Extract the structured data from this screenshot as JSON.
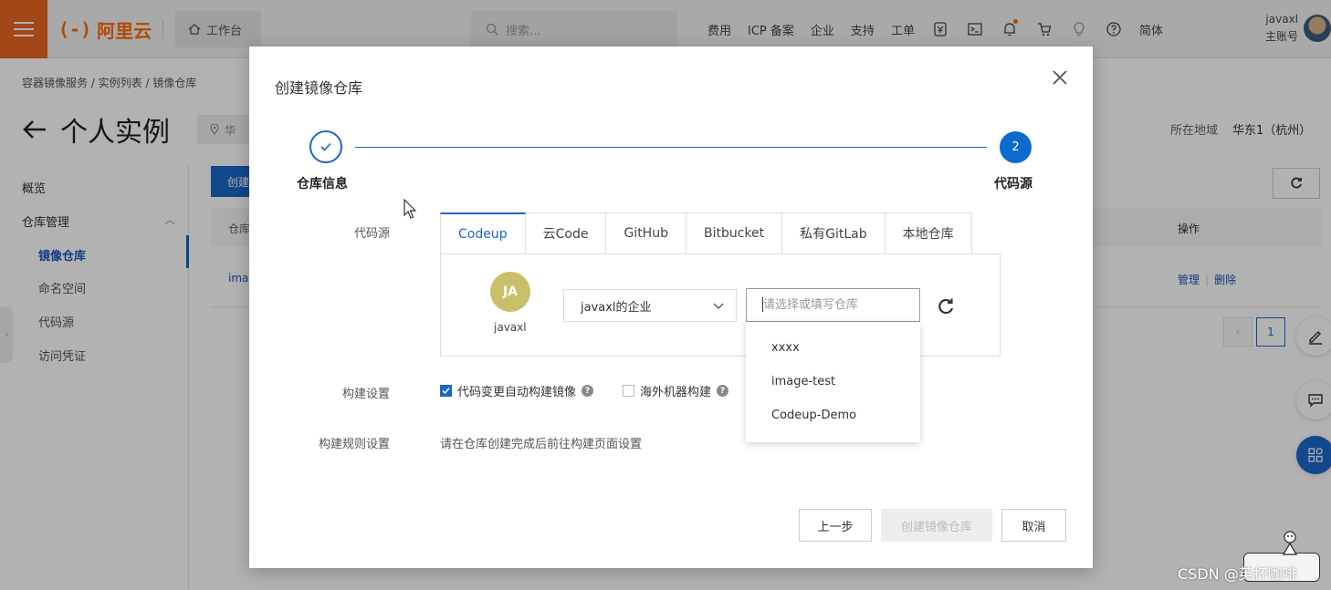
{
  "topbar": {
    "logo_mark": "(-)",
    "logo_text": "阿里云",
    "workbench": "工作台",
    "search_placeholder": "搜索...",
    "nav": [
      "费用",
      "ICP 备案",
      "企业",
      "支持",
      "工单"
    ],
    "lang": "简体",
    "username": "javaxl",
    "account_type": "主账号"
  },
  "page": {
    "breadcrumb": "容器镜像服务 / 实例列表 / 镜像仓库",
    "title": "个人实例",
    "region_chip": "华",
    "region_label": "所在地域",
    "region_value": "华东1（杭州）",
    "create_btn": "创建",
    "table_col_left": "仓库",
    "table_col_ops": "操作",
    "row_name": "ima",
    "row_manage": "管理",
    "row_delete": "删除",
    "page_number": "1"
  },
  "sidebar": {
    "overview": "概览",
    "repo_mgmt": "仓库管理",
    "items": [
      "镜像仓库",
      "命名空间",
      "代码源",
      "访问凭证"
    ]
  },
  "dialog": {
    "title": "创建镜像仓库",
    "step1_label": "仓库信息",
    "step2_number": "2",
    "step2_label": "代码源",
    "source_label": "代码源",
    "tabs": [
      "Codeup",
      "云Code",
      "GitHub",
      "Bitbucket",
      "私有GitLab",
      "本地仓库"
    ],
    "active_tab": "Codeup",
    "avatar_initials": "JA",
    "account_name": "javaxl",
    "org_select": "javaxl的企业",
    "repo_placeholder": "请选择或填写仓库",
    "repo_options": [
      "xxxx",
      "image-test",
      "Codeup-Demo"
    ],
    "build_settings_label": "构建设置",
    "auto_build_label": "代码变更自动构建镜像",
    "auto_build_checked": true,
    "overseas_build_label": "海外机器构建",
    "overseas_build_checked": false,
    "build_rules_label": "构建规则设置",
    "build_rules_text": "请在仓库创建完成后前往构建页面设置",
    "btn_prev": "上一步",
    "btn_create": "创建镜像仓库",
    "btn_cancel": "取消"
  },
  "watermark": "CSDN @英杯咖啡",
  "colors": {
    "brand_orange": "#ff6a00",
    "primary_blue": "#1a67c9"
  }
}
